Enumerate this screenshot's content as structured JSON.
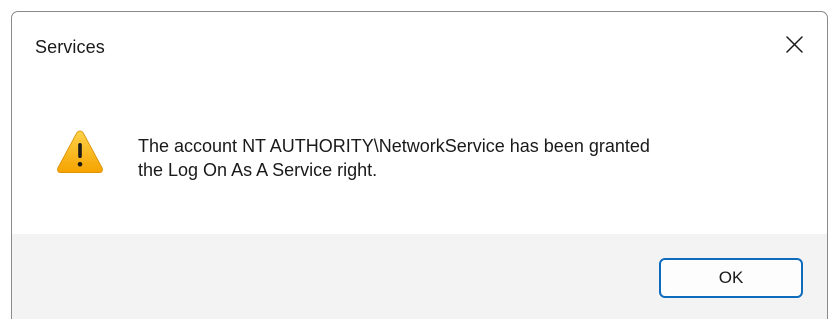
{
  "dialog": {
    "title": "Services",
    "message_lines": [
      "The account NT AUTHORITY\\NetworkService has been granted",
      "the Log On As A Service right."
    ],
    "icon": "warning-icon",
    "ok_label": "OK",
    "close_icon": "close-icon"
  },
  "colors": {
    "accent": "#0f6cbd",
    "warning": "#f8b500",
    "footer_bg": "#f3f3f3"
  }
}
